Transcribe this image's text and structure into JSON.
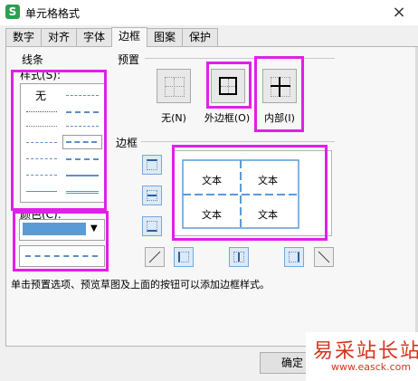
{
  "window": {
    "title": "单元格格式",
    "app_icon": "S",
    "close_symbol": "×"
  },
  "tabs": [
    "数字",
    "对齐",
    "字体",
    "边框",
    "图案",
    "保护"
  ],
  "active_tab": "边框",
  "line_group": {
    "title": "线条",
    "style_label": "样式(S):",
    "none_option": "无",
    "color_label": "颜色(C):",
    "selected_color": "#5b9bd5"
  },
  "presets": {
    "title": "预置",
    "none_label": "无(N)",
    "outline_label": "外边框(O)",
    "inside_label": "内部(I)"
  },
  "border": {
    "title": "边框",
    "preview_text": "文本"
  },
  "description": "单击预置选项、预览草图及上面的按钮可以添加边框样式。",
  "ok_button": "确定",
  "watermark": {
    "line1": "易采站长站",
    "line2": "www.easck.com"
  },
  "highlight_color": "#e020e8"
}
